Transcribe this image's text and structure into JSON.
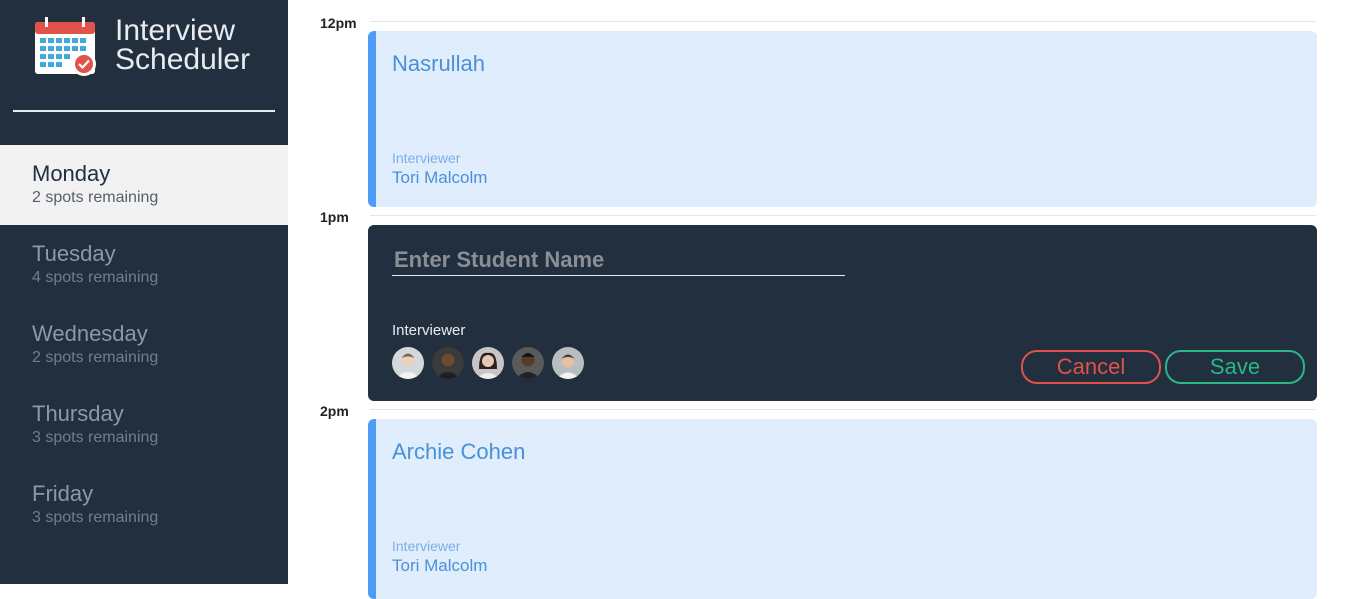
{
  "app": {
    "title_line1": "Interview",
    "title_line2": "Scheduler"
  },
  "sidebar": {
    "days": [
      {
        "name": "Monday",
        "spots": "2 spots remaining",
        "selected": true
      },
      {
        "name": "Tuesday",
        "spots": "4 spots remaining",
        "selected": false
      },
      {
        "name": "Wednesday",
        "spots": "2 spots remaining",
        "selected": false
      },
      {
        "name": "Thursday",
        "spots": "3 spots remaining",
        "selected": false
      },
      {
        "name": "Friday",
        "spots": "3 spots remaining",
        "selected": false
      }
    ]
  },
  "schedule": {
    "times": [
      "12pm",
      "1pm",
      "2pm"
    ],
    "appointments": [
      {
        "student": "Nasrullah",
        "interviewer_label": "Interviewer",
        "interviewer": "Tori Malcolm"
      },
      {
        "student": "Archie Cohen",
        "interviewer_label": "Interviewer",
        "interviewer": "Tori Malcolm"
      }
    ],
    "form": {
      "student_placeholder": "Enter Student Name",
      "student_value": "",
      "interviewer_label": "Interviewer",
      "avatars": [
        "avatar-1",
        "avatar-2",
        "avatar-3",
        "avatar-4",
        "avatar-5"
      ],
      "cancel_label": "Cancel",
      "save_label": "Save"
    }
  },
  "colors": {
    "sidebar_bg": "#222f3e",
    "appointment_bg": "#e0edfc",
    "appointment_accent": "#4e9cf5",
    "cancel": "#e2514a",
    "save": "#2ab689"
  }
}
